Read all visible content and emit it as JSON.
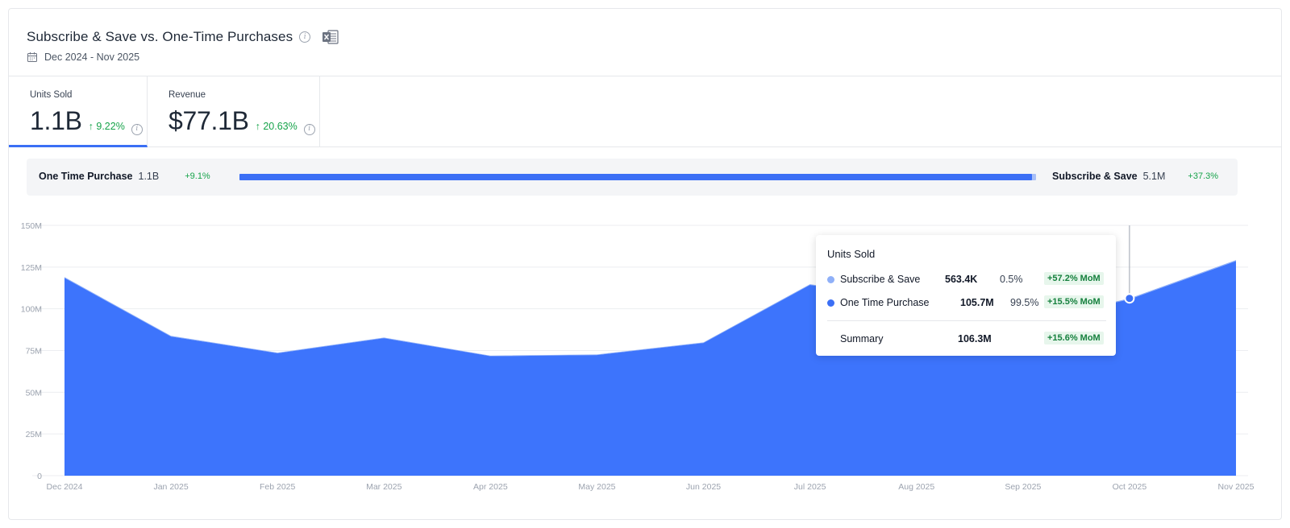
{
  "header": {
    "title": "Subscribe & Save vs. One-Time Purchases",
    "date_range": "Dec 2024 - Nov 2025",
    "info_icon": "i",
    "icons": {
      "info": "info-icon",
      "export": "excel-icon",
      "calendar": "calendar-icon"
    }
  },
  "tabs": [
    {
      "label": "Units Sold",
      "value": "1.1B",
      "change": "↑ 9.22%",
      "active": true
    },
    {
      "label": "Revenue",
      "value": "$77.1B",
      "change": "↑ 20.63%",
      "active": false
    }
  ],
  "split": {
    "left": {
      "name": "One Time Purchase",
      "value": "1.1B",
      "change": "+9.1%"
    },
    "right": {
      "name": "Subscribe & Save",
      "value": "5.1M",
      "change": "+37.3%"
    },
    "left_share": 0.995
  },
  "tooltip": {
    "title": "Units Sold",
    "rows": [
      {
        "name": "Subscribe & Save",
        "value": "563.4K",
        "pct": "0.5%",
        "mom": "+57.2% MoM",
        "color": "#8fb0f8"
      },
      {
        "name": "One Time Purchase",
        "value": "105.7M",
        "pct": "99.5%",
        "mom": "+15.5% MoM",
        "color": "#3b6ff5"
      }
    ],
    "summary": {
      "name": "Summary",
      "value": "106.3M",
      "mom": "+15.6% MoM"
    },
    "hover_index": 10
  },
  "colors": {
    "area": "#3d74fc",
    "subscribe": "#8fb0f8",
    "one_time": "#3b6ff5",
    "positive": "#16a34a"
  },
  "chart_data": {
    "type": "area",
    "categories": [
      "Dec 2024",
      "Jan 2025",
      "Feb 2025",
      "Mar 2025",
      "Apr 2025",
      "May 2025",
      "Jun 2025",
      "Jul 2025",
      "Aug 2025",
      "Sep 2025",
      "Oct 2025",
      "Nov 2025"
    ],
    "series": [
      {
        "name": "Subscribe & Save",
        "values": [
          0.5,
          0.4,
          0.35,
          0.4,
          0.35,
          0.35,
          0.4,
          0.45,
          0.4,
          0.36,
          0.56,
          0.6
        ]
      },
      {
        "name": "One Time Purchase",
        "values": [
          118.5,
          83.4,
          73.4,
          82.4,
          71.6,
          72.3,
          79.5,
          114.3,
          105.0,
          91.1,
          105.7,
          128.6
        ]
      }
    ],
    "stacked": true,
    "ylim": [
      0,
      150
    ],
    "yticks": [
      0,
      25,
      50,
      75,
      100,
      125,
      150
    ],
    "ytick_labels": [
      "0",
      "25M",
      "50M",
      "75M",
      "100M",
      "125M",
      "150M"
    ],
    "grid": true,
    "title": "",
    "xlabel": "",
    "ylabel": ""
  }
}
